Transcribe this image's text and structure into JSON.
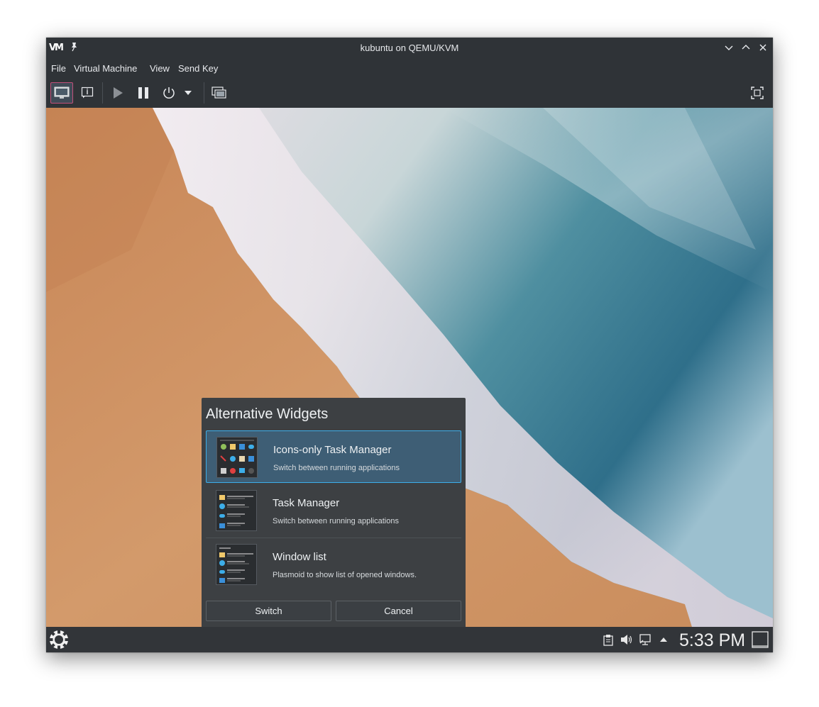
{
  "window": {
    "title": "kubuntu on QEMU/KVM",
    "logo_text": "VM"
  },
  "menu": [
    "File",
    "Virtual Machine",
    "View",
    "Send Key"
  ],
  "toolbar": {
    "icons": [
      "console-icon",
      "details-icon",
      "run-icon",
      "pause-icon",
      "power-icon",
      "power-menu-arrow-icon",
      "snapshots-icon",
      "fullscreen-icon"
    ]
  },
  "dialog": {
    "title": "Alternative Widgets",
    "items": [
      {
        "name": "Icons-only Task Manager",
        "description": "Switch between running applications",
        "selected": true
      },
      {
        "name": "Task Manager",
        "description": "Switch between running applications",
        "selected": false
      },
      {
        "name": "Window list",
        "description": "Plasmoid to show list of opened windows.",
        "selected": false
      }
    ],
    "switch_label": "Switch",
    "cancel_label": "Cancel"
  },
  "panel": {
    "clock": "5:33 PM",
    "tray_icons": [
      "clipboard-icon",
      "volume-icon",
      "network-icon",
      "tray-expand-icon"
    ]
  },
  "colors": {
    "accent": "#3daee9",
    "selection": "#3e5e75",
    "active_toolbar_border": "#c2507a"
  }
}
